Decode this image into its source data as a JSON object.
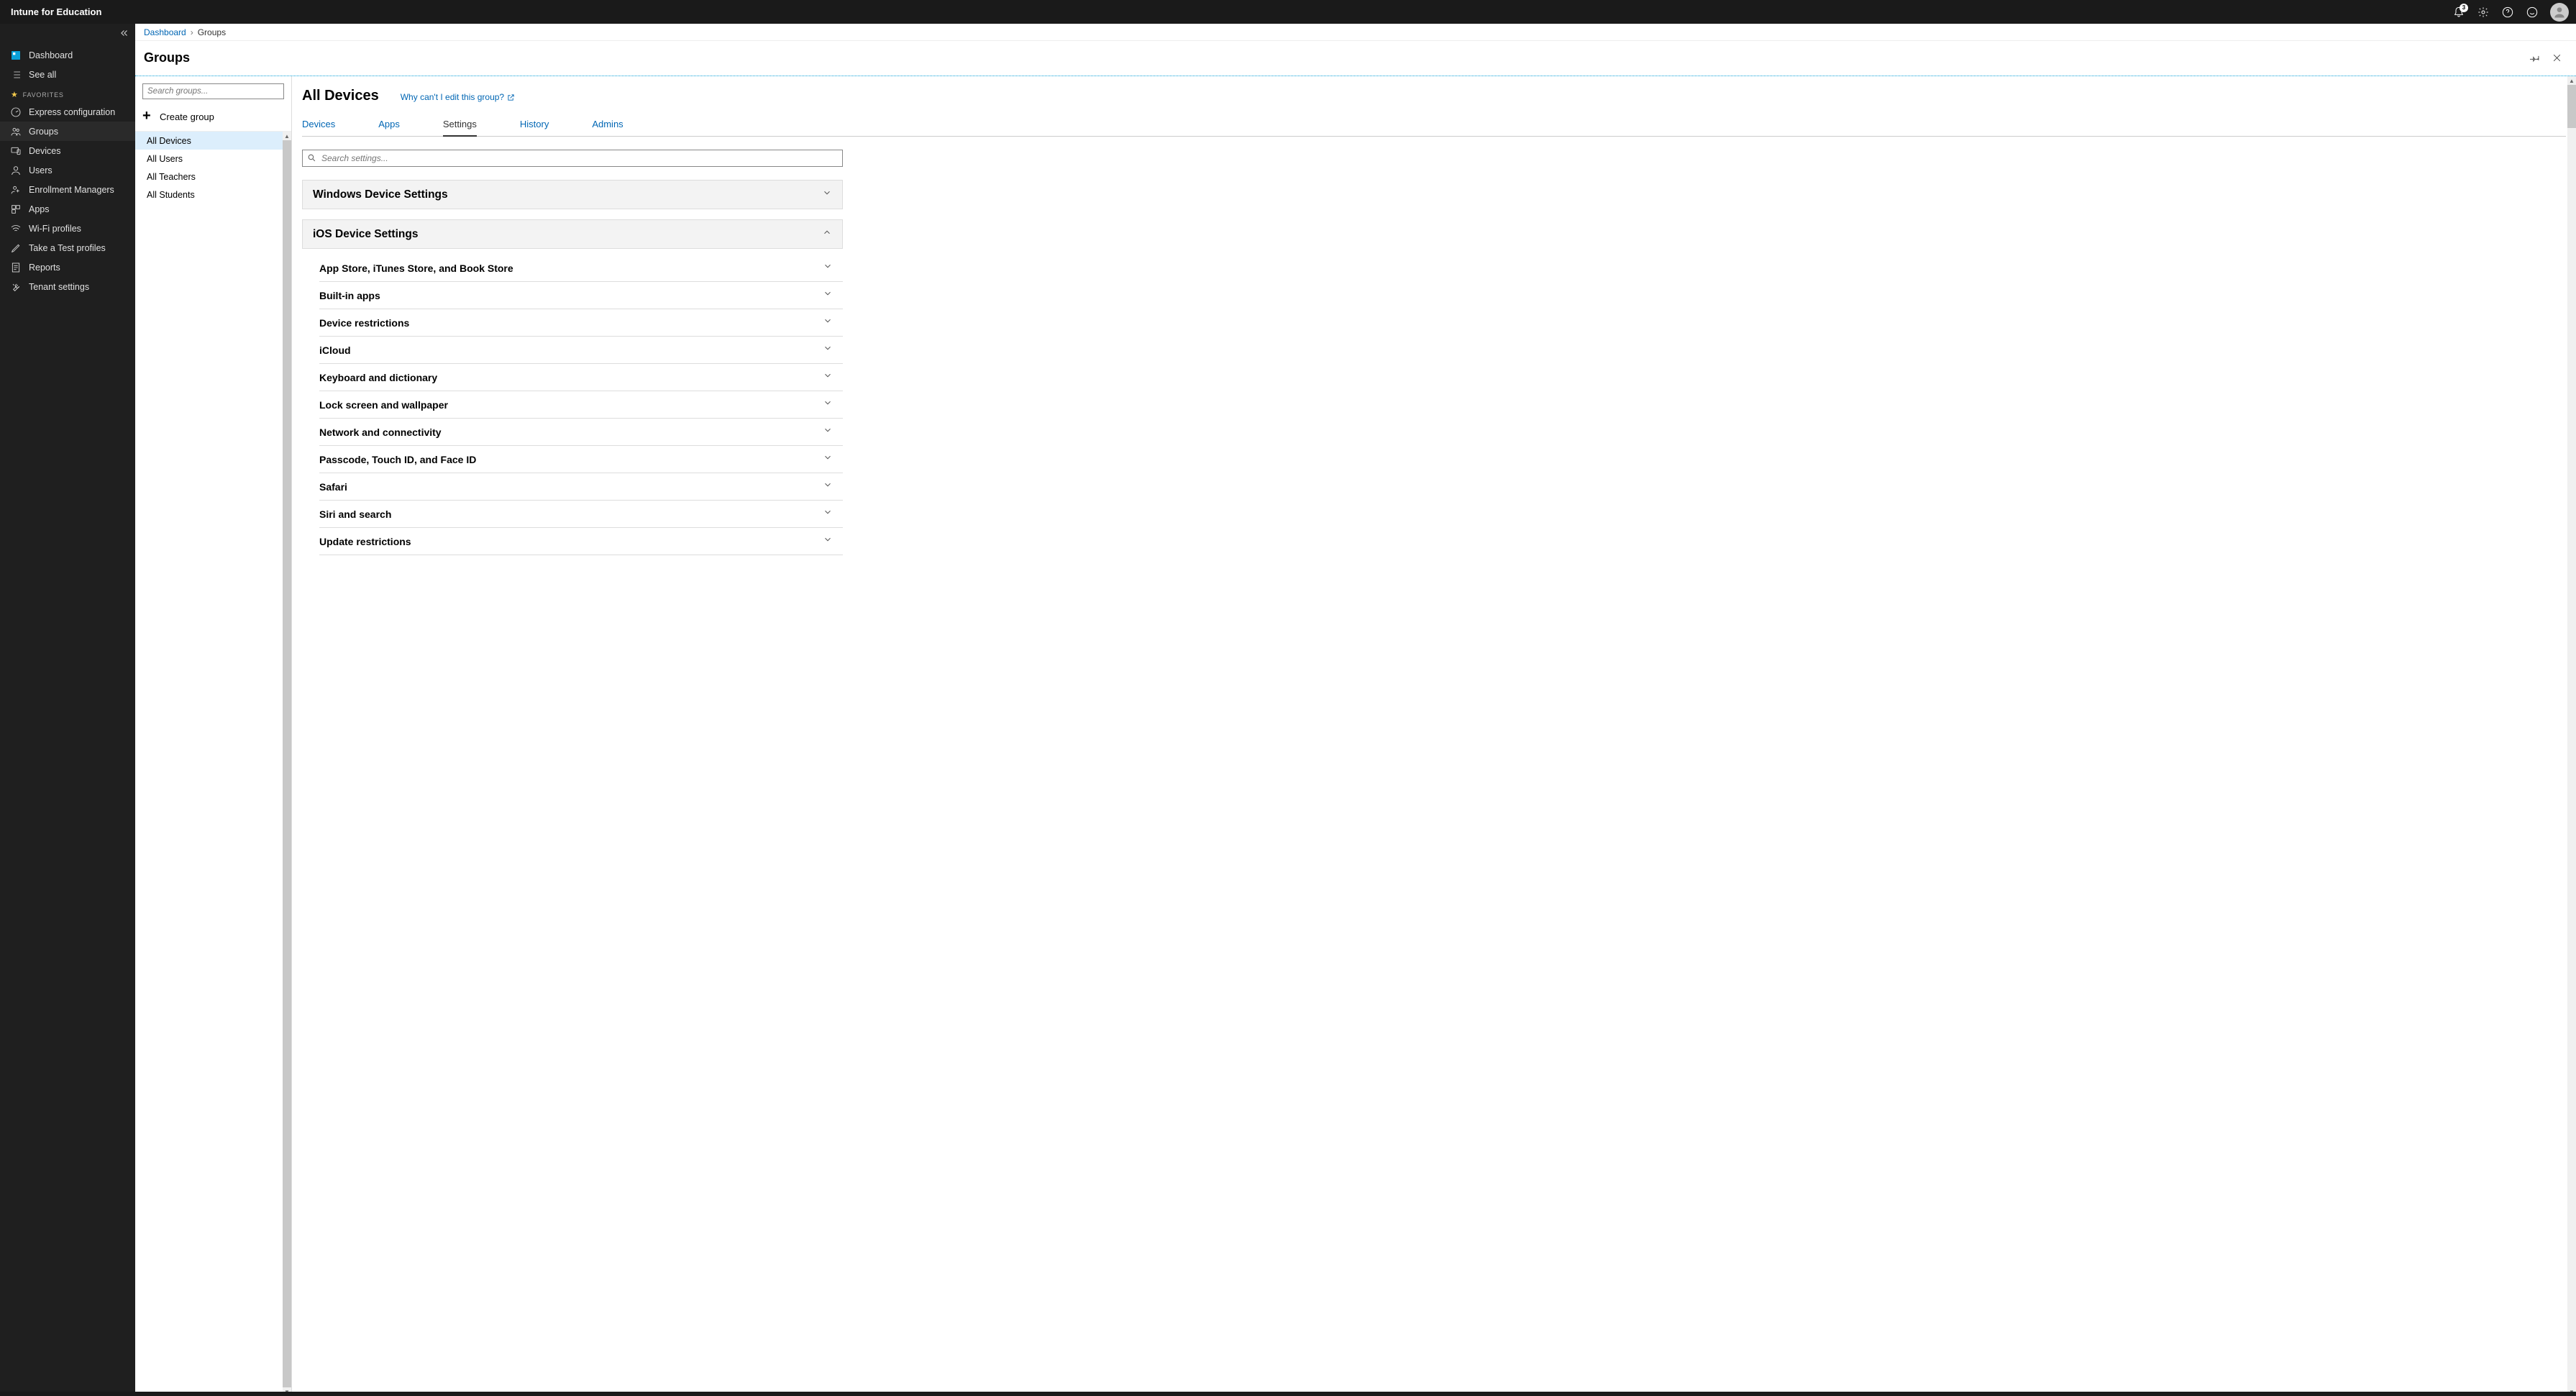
{
  "app": {
    "title": "Intune for Education",
    "notif_count": "3"
  },
  "nav": {
    "dashboard": "Dashboard",
    "see_all": "See all",
    "favorites_label": "FAVORITES",
    "items": [
      {
        "label": "Express configuration"
      },
      {
        "label": "Groups"
      },
      {
        "label": "Devices"
      },
      {
        "label": "Users"
      },
      {
        "label": "Enrollment Managers"
      },
      {
        "label": "Apps"
      },
      {
        "label": "Wi-Fi profiles"
      },
      {
        "label": "Take a Test profiles"
      },
      {
        "label": "Reports"
      },
      {
        "label": "Tenant settings"
      }
    ]
  },
  "breadcrumb": {
    "root": "Dashboard",
    "current": "Groups"
  },
  "page": {
    "title": "Groups"
  },
  "groups": {
    "search_placeholder": "Search groups...",
    "create_label": "Create group",
    "items": [
      {
        "label": "All Devices",
        "selected": true
      },
      {
        "label": "All Users"
      },
      {
        "label": "All Teachers"
      },
      {
        "label": "All Students"
      }
    ]
  },
  "detail": {
    "title": "All Devices",
    "help_link": "Why can't I edit this group?",
    "tabs": [
      {
        "label": "Devices"
      },
      {
        "label": "Apps"
      },
      {
        "label": "Settings",
        "active": true
      },
      {
        "label": "History"
      },
      {
        "label": "Admins"
      }
    ],
    "search_placeholder": "Search settings...",
    "sections": [
      {
        "title": "Windows Device Settings",
        "open": false
      },
      {
        "title": "iOS Device Settings",
        "open": true,
        "subsections": [
          {
            "title": "App Store, iTunes Store, and Book Store"
          },
          {
            "title": "Built-in apps"
          },
          {
            "title": "Device restrictions"
          },
          {
            "title": "iCloud"
          },
          {
            "title": "Keyboard and dictionary"
          },
          {
            "title": "Lock screen and wallpaper"
          },
          {
            "title": "Network and connectivity"
          },
          {
            "title": "Passcode, Touch ID, and Face ID"
          },
          {
            "title": "Safari"
          },
          {
            "title": "Siri and search"
          },
          {
            "title": "Update restrictions"
          }
        ]
      }
    ]
  }
}
